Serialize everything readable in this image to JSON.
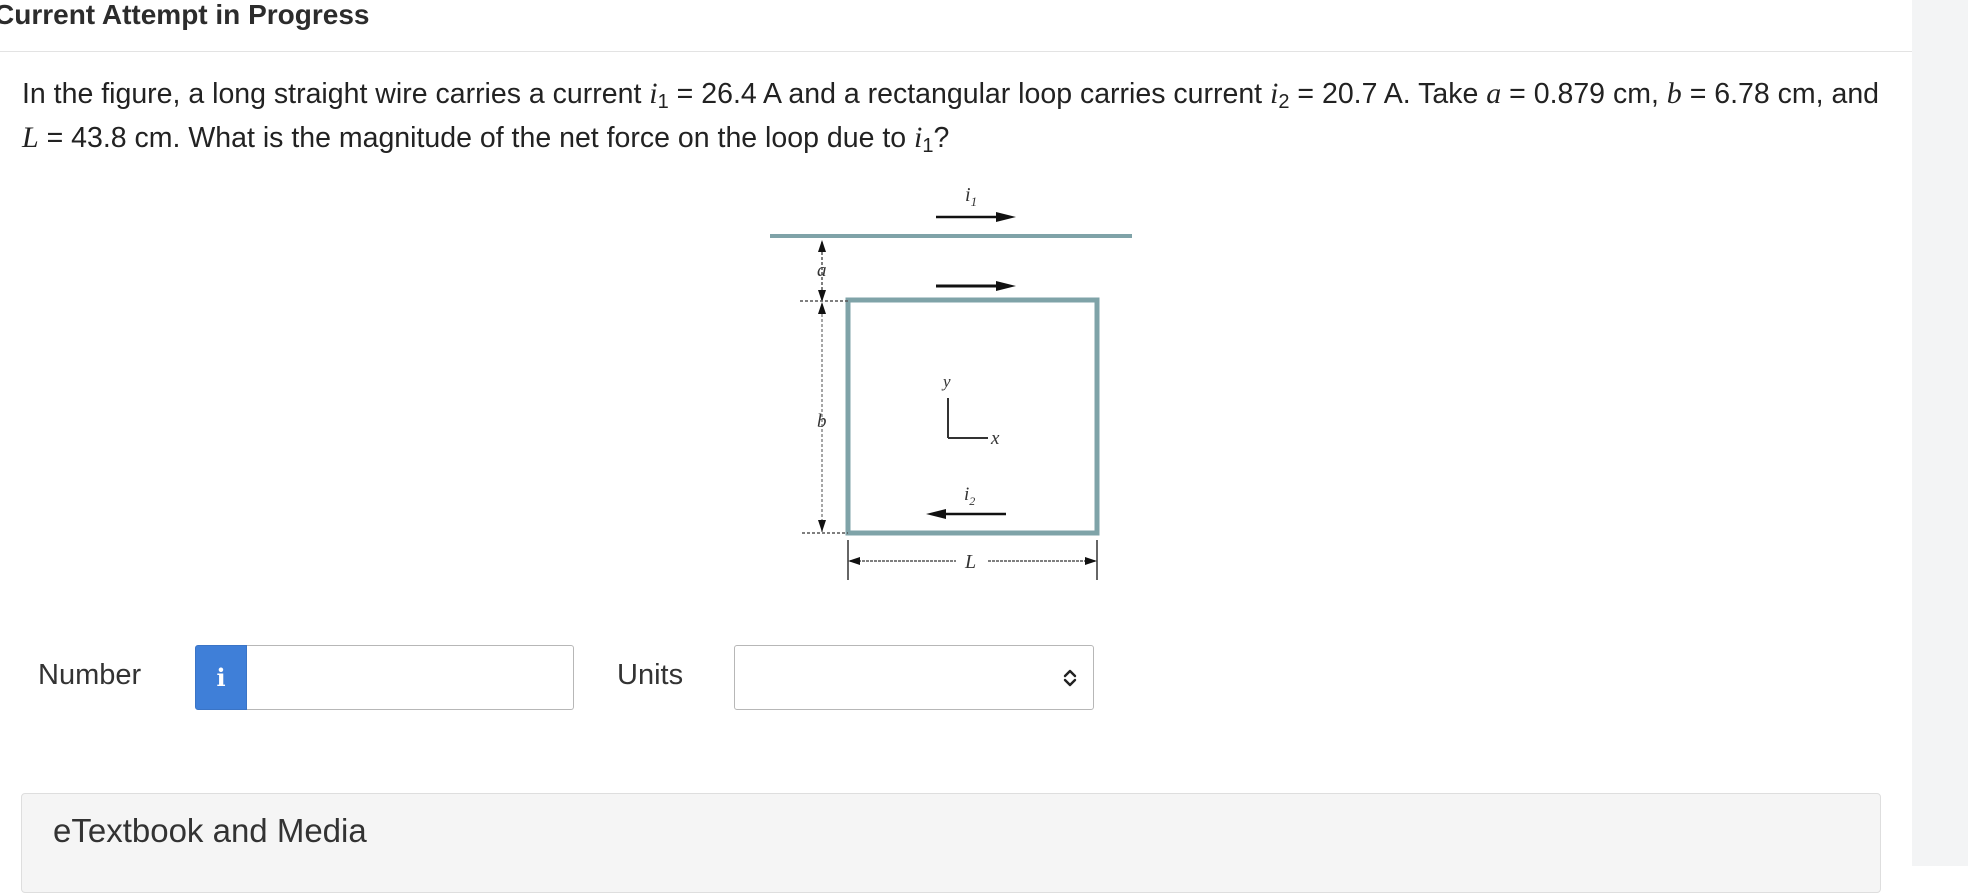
{
  "header": {
    "title": "Current Attempt in Progress"
  },
  "question": {
    "t1": "In the figure, a long straight wire carries a current ",
    "i1_sym": "i",
    "i1_sub": "1",
    "t2": " = 26.4 A and a rectangular loop carries current ",
    "i2_sym": "i",
    "i2_sub": "2",
    "t3": " = 20.7 A. Take ",
    "a_sym": "a",
    "t4": " = 0.879 cm, ",
    "b_sym": "b",
    "t5": " = 6.78 cm, and ",
    "L_sym": "L",
    "t6": " = 43.8 cm. What is the magnitude of the net force on the loop due to ",
    "i1b_sym": "i",
    "i1b_sub": "1",
    "t7": "?"
  },
  "figure": {
    "label_i1": "i",
    "label_i1_sub": "1",
    "label_a": "a",
    "label_b": "b",
    "label_y": "y",
    "label_x": "x",
    "label_i2": "i",
    "label_i2_sub": "2",
    "label_L": "L"
  },
  "answer": {
    "number_label": "Number",
    "info_icon_text": "i",
    "number_value": "",
    "number_placeholder": "",
    "units_label": "Units",
    "units_value": ""
  },
  "etextbook": {
    "title": "eTextbook and Media"
  },
  "colors": {
    "accent": "#3f7fd8",
    "wire": "#7fa3a8",
    "loop": "#7fa3a8"
  },
  "icons": {
    "info": "info-icon",
    "select": "up-down-chevron-icon"
  }
}
